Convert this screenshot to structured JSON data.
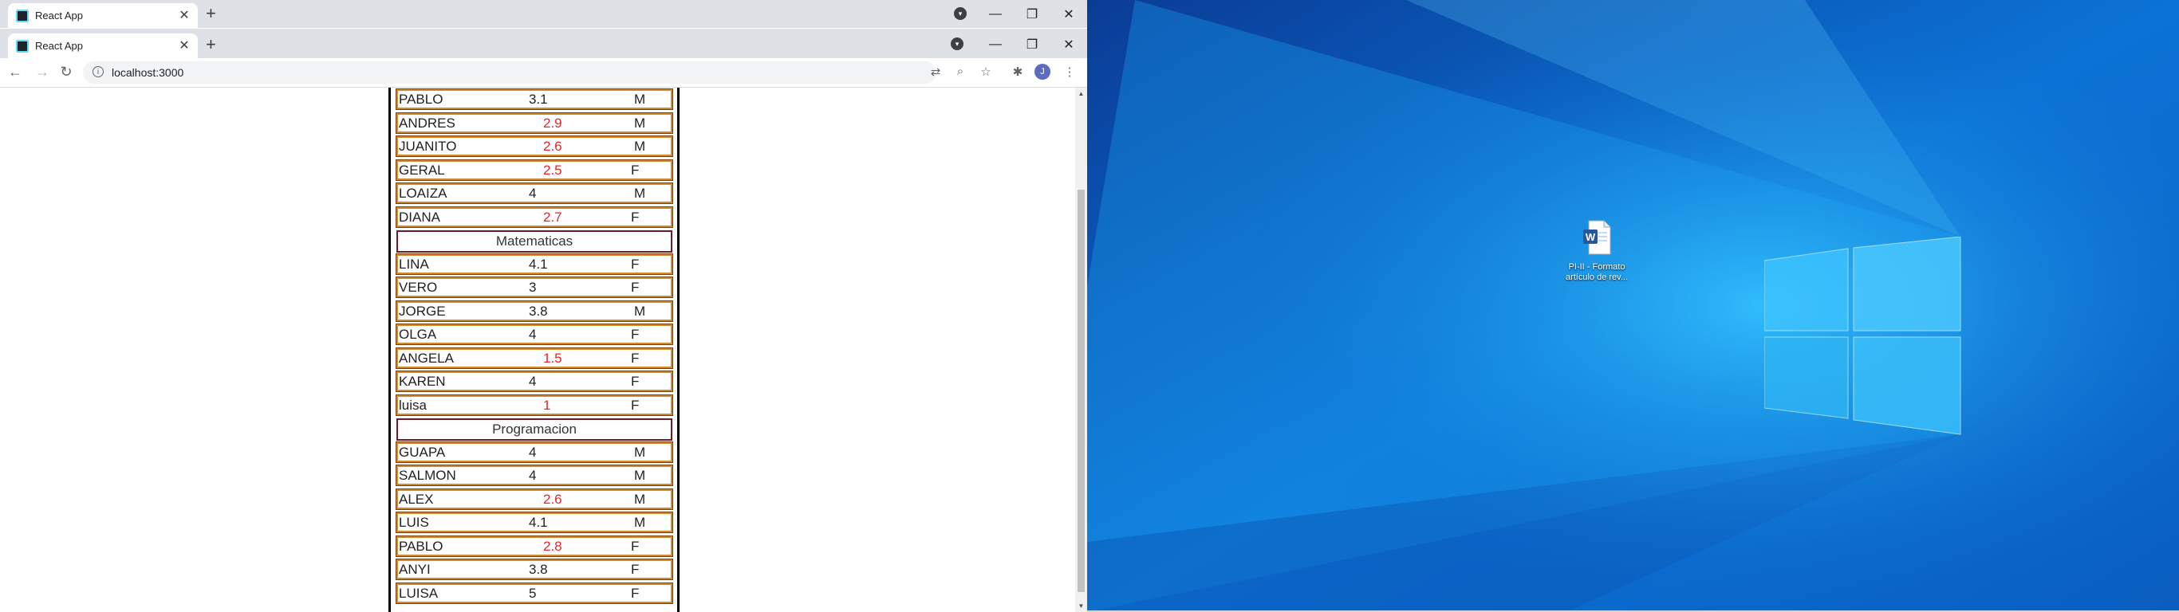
{
  "browser": {
    "tab_title": "React App",
    "url": "localhost:3000",
    "avatar_letter": "J"
  },
  "icons": [
    "favicon-react-icon",
    "close-icon",
    "new-tab-icon",
    "tab-search-icon",
    "minimize-icon",
    "restore-icon",
    "window-close-icon",
    "back-icon",
    "forward-icon",
    "reload-icon",
    "info-icon",
    "translate-icon",
    "zoom-icon",
    "bookmark-star-icon",
    "extensions-icon",
    "menu-icon",
    "word-document-icon",
    "windows-logo-icon"
  ],
  "colors": {
    "low_grade": "#e3262b",
    "row_border": "#d2892d",
    "section_border": "#6b1b2a",
    "desktop_blue": "#0b6fd0"
  },
  "students": {
    "group1": [
      {
        "name": "PABLO",
        "grade": "3.1",
        "sex": "M",
        "low": false
      },
      {
        "name": "ANDRES",
        "grade": "2.9",
        "sex": "M",
        "low": true
      },
      {
        "name": "JUANITO",
        "grade": "2.6",
        "sex": "M",
        "low": true
      },
      {
        "name": "GERAL",
        "grade": "2.5",
        "sex": "F",
        "low": true
      },
      {
        "name": "LOAIZA",
        "grade": "4",
        "sex": "M",
        "low": false
      },
      {
        "name": "DIANA",
        "grade": "2.7",
        "sex": "F",
        "low": true
      }
    ],
    "section_matematicas": "Matematicas",
    "matematicas": [
      {
        "name": "LINA",
        "grade": "4.1",
        "sex": "F",
        "low": false
      },
      {
        "name": "VERO",
        "grade": "3",
        "sex": "F",
        "low": false
      },
      {
        "name": "JORGE",
        "grade": "3.8",
        "sex": "M",
        "low": false
      },
      {
        "name": "OLGA",
        "grade": "4",
        "sex": "F",
        "low": false
      },
      {
        "name": "ANGELA",
        "grade": "1.5",
        "sex": "F",
        "low": true
      },
      {
        "name": "KAREN",
        "grade": "4",
        "sex": "F",
        "low": false
      },
      {
        "name": "luisa",
        "grade": "1",
        "sex": "F",
        "low": true
      }
    ],
    "section_programacion": "Programacion",
    "programacion": [
      {
        "name": "GUAPA",
        "grade": "4",
        "sex": "M",
        "low": false
      },
      {
        "name": "SALMON",
        "grade": "4",
        "sex": "M",
        "low": false
      },
      {
        "name": "ALEX",
        "grade": "2.6",
        "sex": "M",
        "low": true
      },
      {
        "name": "LUIS",
        "grade": "4.1",
        "sex": "M",
        "low": false
      },
      {
        "name": "PABLO",
        "grade": "2.8",
        "sex": "F",
        "low": true
      },
      {
        "name": "ANYI",
        "grade": "3.8",
        "sex": "F",
        "low": false
      },
      {
        "name": "LUISA",
        "grade": "5",
        "sex": "F",
        "low": false
      }
    ]
  },
  "desktop": {
    "icon_label": "PI-II - Formato artículo de rev..."
  }
}
